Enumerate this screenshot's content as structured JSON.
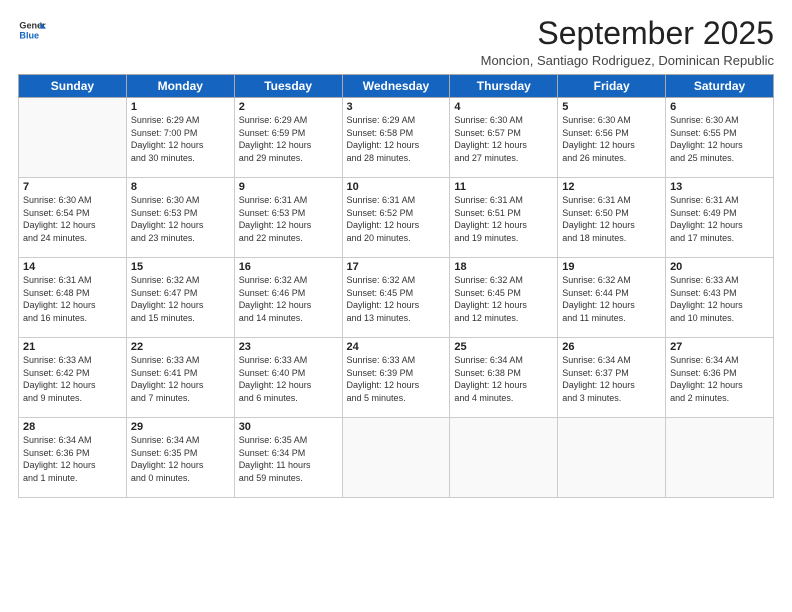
{
  "header": {
    "logo_line1": "General",
    "logo_line2": "Blue",
    "month_title": "September 2025",
    "subtitle": "Moncion, Santiago Rodriguez, Dominican Republic"
  },
  "weekdays": [
    "Sunday",
    "Monday",
    "Tuesday",
    "Wednesday",
    "Thursday",
    "Friday",
    "Saturday"
  ],
  "weeks": [
    [
      {
        "day": "",
        "info": ""
      },
      {
        "day": "1",
        "info": "Sunrise: 6:29 AM\nSunset: 7:00 PM\nDaylight: 12 hours\nand 30 minutes."
      },
      {
        "day": "2",
        "info": "Sunrise: 6:29 AM\nSunset: 6:59 PM\nDaylight: 12 hours\nand 29 minutes."
      },
      {
        "day": "3",
        "info": "Sunrise: 6:29 AM\nSunset: 6:58 PM\nDaylight: 12 hours\nand 28 minutes."
      },
      {
        "day": "4",
        "info": "Sunrise: 6:30 AM\nSunset: 6:57 PM\nDaylight: 12 hours\nand 27 minutes."
      },
      {
        "day": "5",
        "info": "Sunrise: 6:30 AM\nSunset: 6:56 PM\nDaylight: 12 hours\nand 26 minutes."
      },
      {
        "day": "6",
        "info": "Sunrise: 6:30 AM\nSunset: 6:55 PM\nDaylight: 12 hours\nand 25 minutes."
      }
    ],
    [
      {
        "day": "7",
        "info": "Sunrise: 6:30 AM\nSunset: 6:54 PM\nDaylight: 12 hours\nand 24 minutes."
      },
      {
        "day": "8",
        "info": "Sunrise: 6:30 AM\nSunset: 6:53 PM\nDaylight: 12 hours\nand 23 minutes."
      },
      {
        "day": "9",
        "info": "Sunrise: 6:31 AM\nSunset: 6:53 PM\nDaylight: 12 hours\nand 22 minutes."
      },
      {
        "day": "10",
        "info": "Sunrise: 6:31 AM\nSunset: 6:52 PM\nDaylight: 12 hours\nand 20 minutes."
      },
      {
        "day": "11",
        "info": "Sunrise: 6:31 AM\nSunset: 6:51 PM\nDaylight: 12 hours\nand 19 minutes."
      },
      {
        "day": "12",
        "info": "Sunrise: 6:31 AM\nSunset: 6:50 PM\nDaylight: 12 hours\nand 18 minutes."
      },
      {
        "day": "13",
        "info": "Sunrise: 6:31 AM\nSunset: 6:49 PM\nDaylight: 12 hours\nand 17 minutes."
      }
    ],
    [
      {
        "day": "14",
        "info": "Sunrise: 6:31 AM\nSunset: 6:48 PM\nDaylight: 12 hours\nand 16 minutes."
      },
      {
        "day": "15",
        "info": "Sunrise: 6:32 AM\nSunset: 6:47 PM\nDaylight: 12 hours\nand 15 minutes."
      },
      {
        "day": "16",
        "info": "Sunrise: 6:32 AM\nSunset: 6:46 PM\nDaylight: 12 hours\nand 14 minutes."
      },
      {
        "day": "17",
        "info": "Sunrise: 6:32 AM\nSunset: 6:45 PM\nDaylight: 12 hours\nand 13 minutes."
      },
      {
        "day": "18",
        "info": "Sunrise: 6:32 AM\nSunset: 6:45 PM\nDaylight: 12 hours\nand 12 minutes."
      },
      {
        "day": "19",
        "info": "Sunrise: 6:32 AM\nSunset: 6:44 PM\nDaylight: 12 hours\nand 11 minutes."
      },
      {
        "day": "20",
        "info": "Sunrise: 6:33 AM\nSunset: 6:43 PM\nDaylight: 12 hours\nand 10 minutes."
      }
    ],
    [
      {
        "day": "21",
        "info": "Sunrise: 6:33 AM\nSunset: 6:42 PM\nDaylight: 12 hours\nand 9 minutes."
      },
      {
        "day": "22",
        "info": "Sunrise: 6:33 AM\nSunset: 6:41 PM\nDaylight: 12 hours\nand 7 minutes."
      },
      {
        "day": "23",
        "info": "Sunrise: 6:33 AM\nSunset: 6:40 PM\nDaylight: 12 hours\nand 6 minutes."
      },
      {
        "day": "24",
        "info": "Sunrise: 6:33 AM\nSunset: 6:39 PM\nDaylight: 12 hours\nand 5 minutes."
      },
      {
        "day": "25",
        "info": "Sunrise: 6:34 AM\nSunset: 6:38 PM\nDaylight: 12 hours\nand 4 minutes."
      },
      {
        "day": "26",
        "info": "Sunrise: 6:34 AM\nSunset: 6:37 PM\nDaylight: 12 hours\nand 3 minutes."
      },
      {
        "day": "27",
        "info": "Sunrise: 6:34 AM\nSunset: 6:36 PM\nDaylight: 12 hours\nand 2 minutes."
      }
    ],
    [
      {
        "day": "28",
        "info": "Sunrise: 6:34 AM\nSunset: 6:36 PM\nDaylight: 12 hours\nand 1 minute."
      },
      {
        "day": "29",
        "info": "Sunrise: 6:34 AM\nSunset: 6:35 PM\nDaylight: 12 hours\nand 0 minutes."
      },
      {
        "day": "30",
        "info": "Sunrise: 6:35 AM\nSunset: 6:34 PM\nDaylight: 11 hours\nand 59 minutes."
      },
      {
        "day": "",
        "info": ""
      },
      {
        "day": "",
        "info": ""
      },
      {
        "day": "",
        "info": ""
      },
      {
        "day": "",
        "info": ""
      }
    ]
  ]
}
